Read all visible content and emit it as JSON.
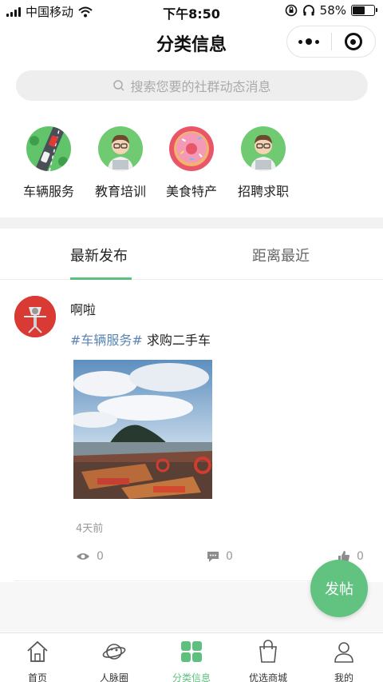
{
  "status_bar": {
    "carrier": "中国移动",
    "time": "下午8:50",
    "battery": "58%",
    "battery_level": 0.58
  },
  "nav": {
    "title": "分类信息"
  },
  "search": {
    "placeholder": "搜索您要的社群动态消息"
  },
  "categories": [
    {
      "label": "车辆服务",
      "icon": "car-road-icon"
    },
    {
      "label": "教育培训",
      "icon": "teacher-avatar-icon"
    },
    {
      "label": "美食特产",
      "icon": "donut-icon"
    },
    {
      "label": "招聘求职",
      "icon": "recruit-avatar-icon"
    }
  ],
  "tabs": [
    {
      "label": "最新发布",
      "active": true
    },
    {
      "label": "距离最近",
      "active": false
    }
  ],
  "post": {
    "username": "啊啦",
    "tag": "#车辆服务#",
    "text": "求购二手车",
    "time": "4天前",
    "views": "0",
    "comments": "0",
    "likes": "0"
  },
  "fab": {
    "label": "发帖"
  },
  "tabbar": [
    {
      "label": "首页",
      "icon": "home-icon",
      "active": false
    },
    {
      "label": "人脉圈",
      "icon": "planet-icon",
      "active": false
    },
    {
      "label": "分类信息",
      "icon": "grid-icon",
      "active": true
    },
    {
      "label": "优选商城",
      "icon": "shopping-bag-icon",
      "active": false
    },
    {
      "label": "我的",
      "icon": "user-icon",
      "active": false
    }
  ],
  "colors": {
    "accent": "#5ec07f",
    "tag": "#5b86b3",
    "fab": "#62c381"
  }
}
